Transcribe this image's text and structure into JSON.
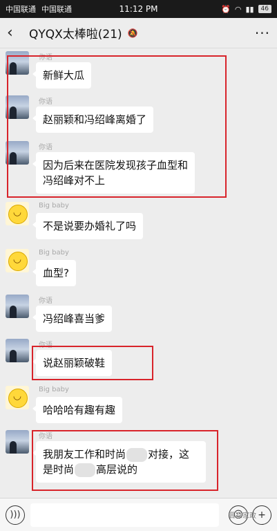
{
  "status_bar": {
    "carrier1": "中国联通",
    "carrier2": "中国联通",
    "time": "11:12 PM",
    "battery": "46"
  },
  "header": {
    "title": "QYQX太棒啦(21)"
  },
  "messages": [
    {
      "sender": "你语",
      "text": "新鲜大瓜",
      "avatar": "scenic"
    },
    {
      "sender": "你语",
      "text": "赵丽颖和冯绍峰离婚了",
      "avatar": "scenic"
    },
    {
      "sender": "你语",
      "text_line1": "因为后来在医院发现孩子血型和",
      "text_line2": "冯绍峰对不上",
      "avatar": "scenic"
    },
    {
      "sender": "Big baby",
      "text": "不是说要办婚礼了吗",
      "avatar": "emoji"
    },
    {
      "sender": "Big baby",
      "text": "血型?",
      "avatar": "emoji"
    },
    {
      "sender": "你语",
      "text": "冯绍峰喜当爹",
      "avatar": "scenic"
    },
    {
      "sender": "你语",
      "text": "说赵丽颖破鞋",
      "avatar": "scenic"
    },
    {
      "sender": "Big baby",
      "text": "哈哈哈有趣有趣",
      "avatar": "emoji"
    },
    {
      "sender": "你语",
      "line1_a": "我朋友工作和时尚",
      "line1_b": "对接，这",
      "line2_a": "是时尚",
      "line2_b": "高层说的",
      "avatar": "scenic"
    }
  ],
  "watermark": "晋京家政"
}
